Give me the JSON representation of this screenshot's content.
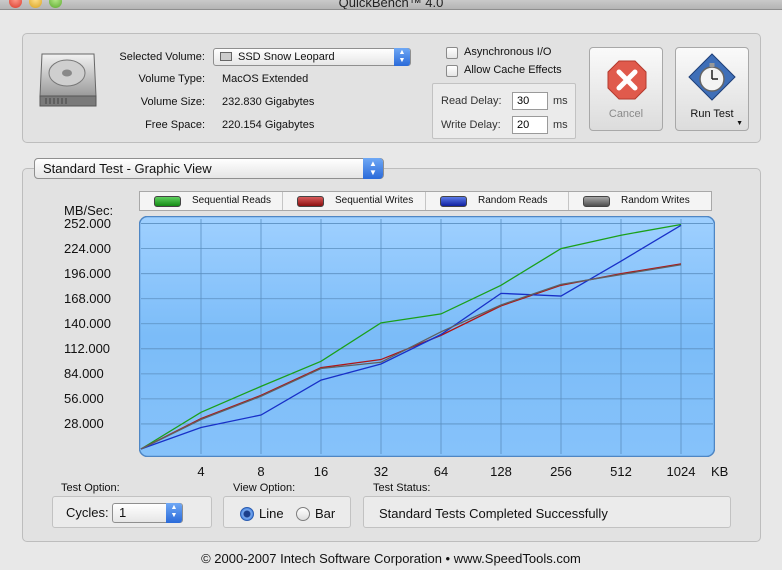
{
  "window": {
    "title": "QuickBench™ 4.0"
  },
  "volume": {
    "selected_label": "Selected Volume:",
    "selected_value": "SSD Snow Leopard",
    "type_label": "Volume Type:",
    "type_value": "MacOS Extended",
    "size_label": "Volume Size:",
    "size_value": "232.830 Gigabytes",
    "free_label": "Free Space:",
    "free_value": "220.154 Gigabytes"
  },
  "options": {
    "async_io": {
      "label": "Asynchronous I/O",
      "checked": false
    },
    "cache_effects": {
      "label": "Allow Cache Effects",
      "checked": false
    },
    "read_delay_label": "Read Delay:",
    "read_delay_value": "30",
    "write_delay_label": "Write Delay:",
    "write_delay_value": "20",
    "unit": "ms"
  },
  "buttons": {
    "cancel": "Cancel",
    "run_test": "Run Test"
  },
  "test_view": {
    "selected": "Standard Test - Graphic View"
  },
  "legend": [
    {
      "label": "Sequential Reads",
      "color": "#1aa01a"
    },
    {
      "label": "Sequential Writes",
      "color": "#b01515"
    },
    {
      "label": "Random Reads",
      "color": "#1830c8"
    },
    {
      "label": "Random Writes",
      "color": "#606060"
    }
  ],
  "chart_data": {
    "type": "line",
    "ylabel": "MB/Sec:",
    "xlabel": "KB",
    "categories": [
      "4",
      "8",
      "16",
      "32",
      "64",
      "128",
      "256",
      "512",
      "1024"
    ],
    "y_ticks": [
      "252.000",
      "224.000",
      "196.000",
      "168.000",
      "140.000",
      "112.000",
      "84.000",
      "56.000",
      "28.000"
    ],
    "ylim": [
      0,
      256
    ],
    "grid": true,
    "series": [
      {
        "name": "Sequential Reads",
        "color": "#1aa01a",
        "values": [
          41,
          70,
          98,
          141,
          151,
          183,
          224,
          239,
          251
        ]
      },
      {
        "name": "Sequential Writes",
        "color": "#b01515",
        "values": [
          34,
          60,
          91,
          100,
          127,
          160,
          183,
          196,
          207
        ]
      },
      {
        "name": "Random Reads",
        "color": "#1830c8",
        "values": [
          24,
          38,
          77,
          95,
          128,
          174,
          171,
          210,
          250
        ]
      },
      {
        "name": "Random Writes",
        "color": "#606060",
        "values": [
          33,
          59,
          90,
          97,
          131,
          161,
          184,
          195,
          206
        ]
      }
    ]
  },
  "bottom": {
    "test_option_label": "Test Option:",
    "cycles_label": "Cycles:",
    "cycles_value": "1",
    "view_option_label": "View Option:",
    "view_line": "Line",
    "view_bar": "Bar",
    "test_status_label": "Test Status:",
    "test_status_value": "Standard Tests Completed Successfully"
  },
  "footer": "© 2000-2007 Intech Software Corporation • www.SpeedTools.com"
}
